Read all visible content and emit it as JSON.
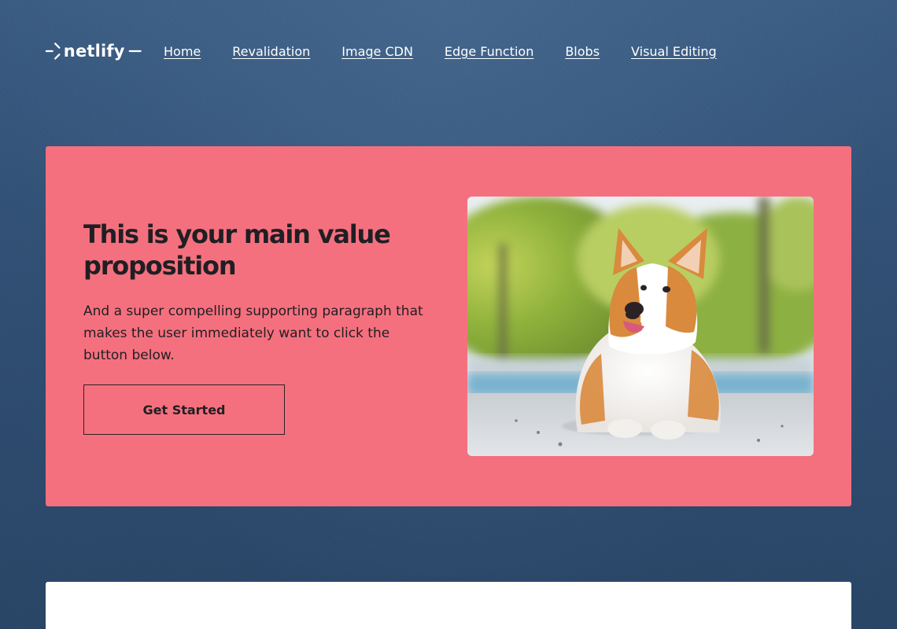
{
  "header": {
    "logo_text": "netlify",
    "nav": [
      {
        "label": "Home"
      },
      {
        "label": "Revalidation"
      },
      {
        "label": "Image CDN"
      },
      {
        "label": "Edge Function"
      },
      {
        "label": "Blobs"
      },
      {
        "label": "Visual Editing"
      }
    ]
  },
  "hero": {
    "title": "This is your main value proposition",
    "text": "And a super compelling supporting paragraph that makes the user immediately want to click the button below.",
    "cta_label": "Get Started",
    "image_icon": "corgi-photo"
  },
  "colors": {
    "background": "#2e4b6e",
    "hero_bg": "#f5707e",
    "text_dark": "#1f1f23",
    "card_bg": "#ffffff"
  }
}
